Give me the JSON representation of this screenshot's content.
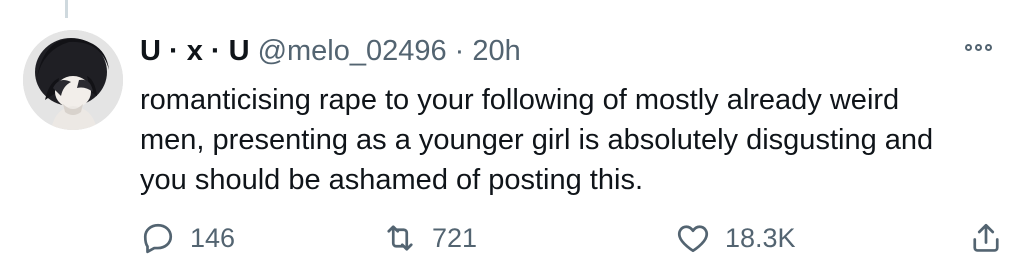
{
  "tweet": {
    "display_name": "U · x · U",
    "handle": "@melo_02496",
    "separator": "·",
    "time": "20h",
    "text_lines": [
      "romanticising rape to your following of mostly already weird",
      "men, presenting as a younger girl is absolutely disgusting and",
      "you should be ashamed of posting this."
    ],
    "avatar_icon": "user-avatar",
    "more_icon": "more-options-icon",
    "actions": {
      "reply_count": "146",
      "retweet_count": "721",
      "like_count": "18.3K"
    }
  },
  "colors": {
    "text": "#0f1419",
    "secondary": "#536471",
    "thread_line": "#cfd9de"
  }
}
